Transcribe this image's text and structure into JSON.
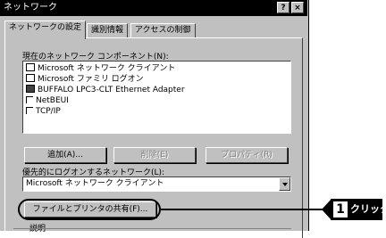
{
  "window": {
    "title": "ネットワーク",
    "help_btn": "?",
    "close_btn": "×"
  },
  "tabs": [
    {
      "label": "ネットワークの設定"
    },
    {
      "label": "識別情報"
    },
    {
      "label": "アクセスの制御"
    }
  ],
  "components": {
    "label": "現在のネットワーク コンポーネント(N):",
    "items": [
      {
        "label": "Microsoft ネットワーク クライアント",
        "icon": "client-icon"
      },
      {
        "label": "Microsoft ファミリ ログオン",
        "icon": "client-icon"
      },
      {
        "label": "BUFFALO LPC3-CLT Ethernet Adapter",
        "icon": "network-adapter-icon"
      },
      {
        "label": "NetBEUI",
        "icon": "protocol-icon"
      },
      {
        "label": "TCP/IP",
        "icon": "protocol-icon"
      }
    ]
  },
  "buttons": {
    "add": "追加(A)...",
    "remove": "削除(E)",
    "properties": "プロパティ(R)",
    "file_print_sharing": "ファイルとプリンタの共有(F)..."
  },
  "logon": {
    "label": "優先的にログオンするネットワーク(L):",
    "value": "Microsoft ネットワーク クライアント"
  },
  "description": {
    "label": "説明"
  },
  "callout": {
    "number": "1",
    "text": "クリック"
  }
}
